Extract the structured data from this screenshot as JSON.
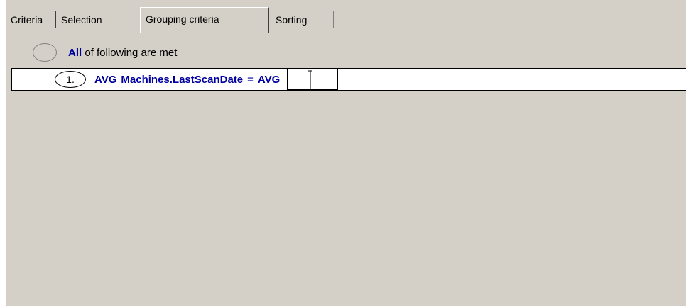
{
  "tabs": [
    {
      "label": "Criteria",
      "active": false
    },
    {
      "label": "Selection",
      "active": false
    },
    {
      "label": "Grouping criteria",
      "active": true
    },
    {
      "label": "Sorting",
      "active": false
    }
  ],
  "group": {
    "quantifier": "All",
    "text": " of following are met"
  },
  "criterion": {
    "number": "1.",
    "func_left": "AVG",
    "field": "Machines.LastScanDate",
    "operator": "=",
    "func_right": "AVG",
    "value": ""
  },
  "icons": {
    "cursor": "text-cursor-icon"
  }
}
